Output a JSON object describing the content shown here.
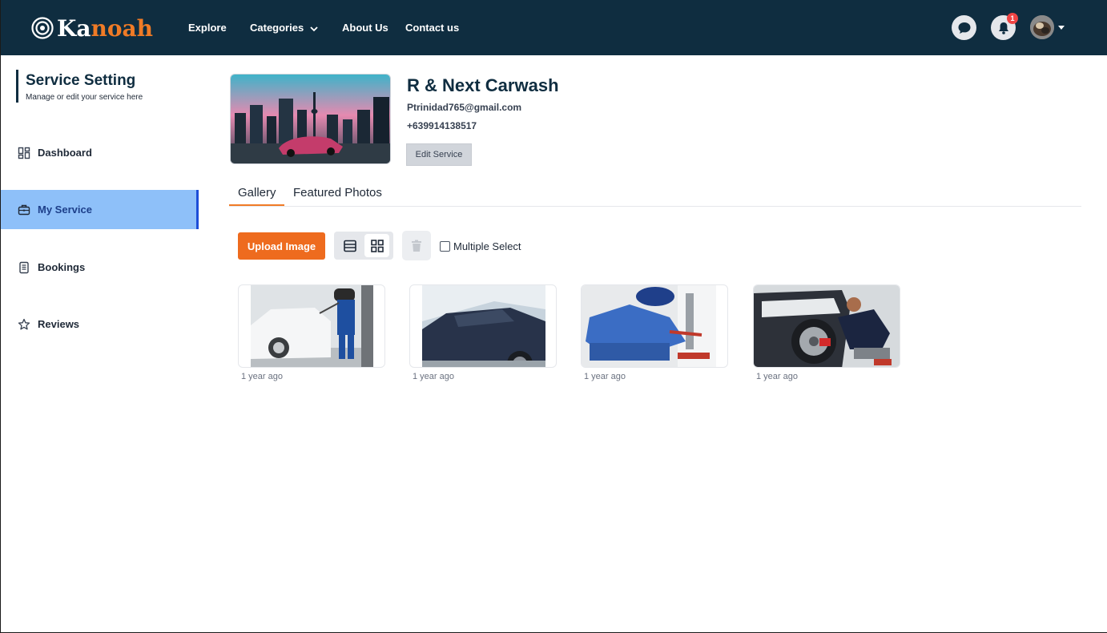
{
  "brand": {
    "name_part1": "Ka",
    "name_part2": "noah"
  },
  "nav": {
    "explore": "Explore",
    "categories": "Categories",
    "about": "About Us",
    "contact": "Contact us",
    "notification_count": "1"
  },
  "sidebar": {
    "title": "Service Setting",
    "subtitle": "Manage or edit your service here",
    "items": [
      {
        "label": "Dashboard",
        "icon": "dashboard-icon"
      },
      {
        "label": "My Service",
        "icon": "briefcase-icon",
        "active": true
      },
      {
        "label": "Bookings",
        "icon": "book-icon"
      },
      {
        "label": "Reviews",
        "icon": "star-icon"
      }
    ]
  },
  "service": {
    "name": "R & Next Carwash",
    "email": "Ptrinidad765@gmail.com",
    "phone": "+639914138517",
    "edit_label": "Edit Service"
  },
  "tabs": [
    {
      "label": "Gallery",
      "active": true
    },
    {
      "label": "Featured Photos",
      "active": false
    }
  ],
  "toolbar": {
    "upload_label": "Upload Image",
    "multi_select_label": "Multiple Select",
    "view_mode": "grid"
  },
  "gallery": [
    {
      "time": "1 year ago"
    },
    {
      "time": "1 year ago"
    },
    {
      "time": "1 year ago"
    },
    {
      "time": "1 year ago"
    }
  ],
  "colors": {
    "navbar": "#0f2d40",
    "accent": "#ee6b1e",
    "active_sidebar": "#8ec0f9"
  }
}
